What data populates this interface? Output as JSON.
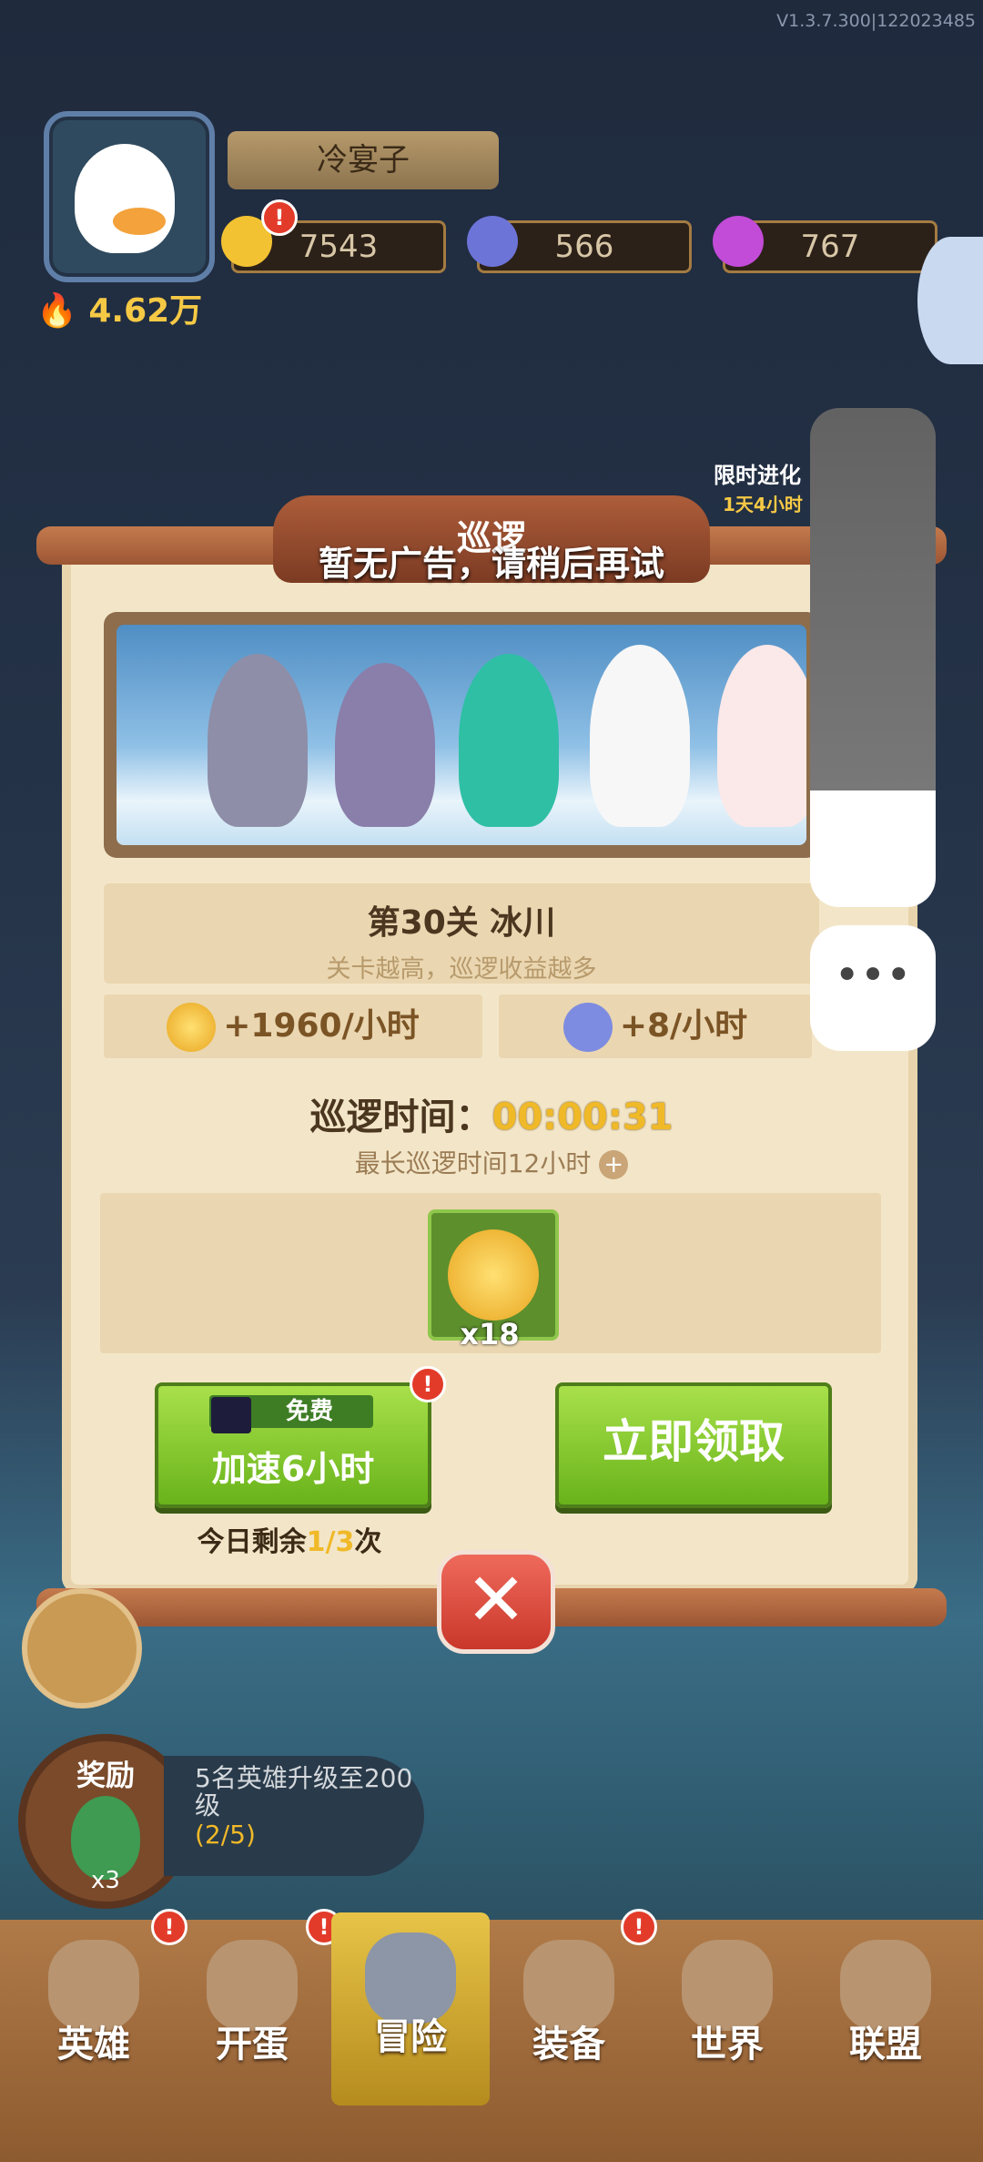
{
  "version": "V1.3.7.300|122023485",
  "player": {
    "name": "冷宴子",
    "power": "4.62万"
  },
  "resources": [
    {
      "name": "gold",
      "value": "7543",
      "color": "#f2c232"
    },
    {
      "name": "gem",
      "value": "566",
      "color": "#6d74d8"
    },
    {
      "name": "crystal",
      "value": "767",
      "color": "#c24bd8"
    }
  ],
  "side_labels": {
    "limited_event": "限时进化",
    "timer": "1天4小时"
  },
  "popup": {
    "title": "巡逻",
    "toast": "暂无广告，请稍后再试",
    "stage_title": "第30关 冰川",
    "stage_sub": "关卡越高，巡逻收益越多",
    "gold_rate": "+1960/小时",
    "gem_rate": "+8/小时",
    "patrol_label": "巡逻时间：",
    "patrol_time": "00:00:31",
    "max_time": "最长巡逻时间12小时",
    "reward_count": "x18",
    "speed_free": "免费",
    "speed_label": "加速6小时",
    "claim_label": "立即领取",
    "remain_prefix": "今日剩余",
    "remain_value": "1/3",
    "remain_suffix": "次"
  },
  "task": {
    "reward_label": "奖励",
    "reward_count": "x3",
    "title": "5名英雄升级至200级",
    "progress": "(2/5)"
  },
  "nav": [
    "英雄",
    "开蛋",
    "冒险",
    "装备",
    "世界",
    "联盟"
  ],
  "active_nav": "冒险"
}
